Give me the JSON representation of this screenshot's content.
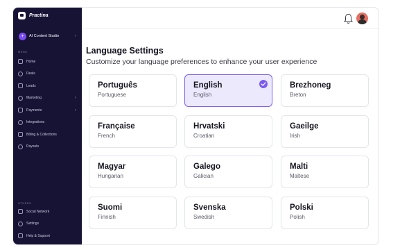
{
  "app": {
    "name": "Practina"
  },
  "studio": {
    "badge": "+",
    "label": "AI Content Studio"
  },
  "sidebar": {
    "menu_label": "MENU",
    "items": [
      {
        "label": "Home",
        "icon": "home-icon",
        "chevron": false
      },
      {
        "label": "Deals",
        "icon": "deals-icon",
        "chevron": false
      },
      {
        "label": "Leads",
        "icon": "filter-icon",
        "chevron": false
      },
      {
        "label": "Marketing",
        "icon": "megaphone-icon",
        "chevron": true
      },
      {
        "label": "Payments",
        "icon": "card-icon",
        "chevron": true
      },
      {
        "label": "Integrations",
        "icon": "integrations-icon",
        "chevron": false
      },
      {
        "label": "Billing & Collections",
        "icon": "billing-icon",
        "chevron": false
      },
      {
        "label": "Payouts",
        "icon": "payouts-icon",
        "chevron": false
      }
    ],
    "others_label": "OTHERS",
    "other_items": [
      {
        "label": "Social Network",
        "icon": "social-icon"
      },
      {
        "label": "Settings",
        "icon": "settings-icon"
      },
      {
        "label": "Help & Support",
        "icon": "help-icon"
      }
    ]
  },
  "header": {
    "notification_icon": "bell-icon",
    "avatar": "user-avatar"
  },
  "main": {
    "title": "Language Settings",
    "subtitle": "Customize your language preferences to enhance your user experience",
    "selected": "English",
    "languages": [
      {
        "native": "Português",
        "english": "Portuguese"
      },
      {
        "native": "English",
        "english": "English"
      },
      {
        "native": "Brezhoneg",
        "english": "Breton"
      },
      {
        "native": "Française",
        "english": "French"
      },
      {
        "native": "Hrvatski",
        "english": "Croatian"
      },
      {
        "native": "Gaeilge",
        "english": "Irish"
      },
      {
        "native": "Magyar",
        "english": "Hungarian"
      },
      {
        "native": "Galego",
        "english": "Galician"
      },
      {
        "native": "Malti",
        "english": "Maltese"
      },
      {
        "native": "Suomi",
        "english": "Finnish"
      },
      {
        "native": "Svenska",
        "english": "Swedish"
      },
      {
        "native": "Polski",
        "english": "Polish"
      }
    ]
  },
  "colors": {
    "sidebar_bg": "#171335",
    "accent": "#7b5cf0",
    "selected_bg": "#ece9fd"
  }
}
